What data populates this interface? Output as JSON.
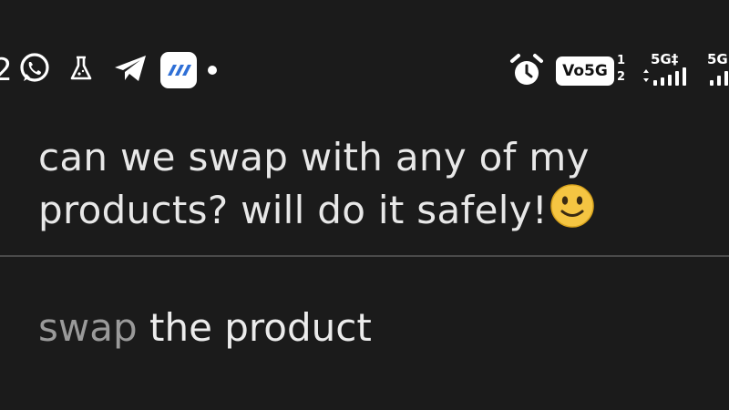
{
  "status_bar": {
    "notification_count": "2",
    "notification_icons": [
      "whatsapp-icon",
      "flask-icon",
      "telegram-icon",
      "app-icon",
      "more-dot-icon"
    ],
    "alarm_icon": "alarm-icon",
    "volte_label": "Vo5G",
    "sim_numbers": [
      "1",
      "2"
    ],
    "network1": "5G‡",
    "network2": "5G"
  },
  "message": {
    "line1": "can we swap with any of my",
    "line2": "products? will do it safely!",
    "emoji": "slightly-smiling-face"
  },
  "compose": {
    "first_word": "swap",
    "rest": " the product"
  },
  "colors": {
    "background": "#1b1b1b",
    "text": "#e8e8e8",
    "muted_text": "#9a9a9a",
    "divider": "#4a4a4a",
    "emoji_face": "#f5c542",
    "app_icon_blue": "#2f6fd6"
  }
}
